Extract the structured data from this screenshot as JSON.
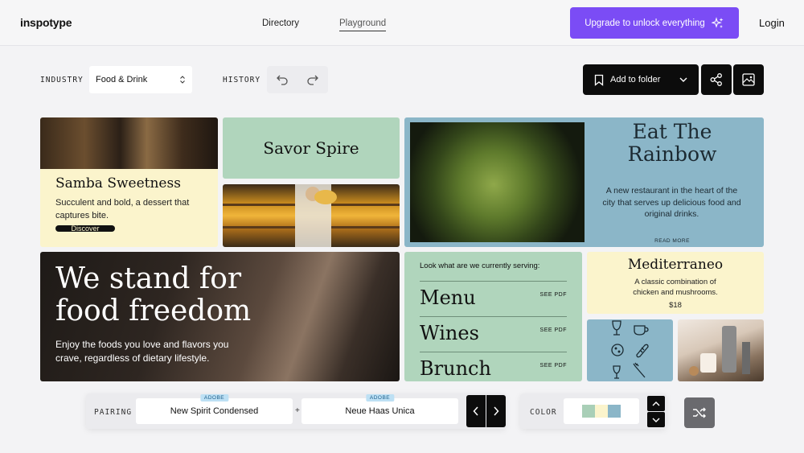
{
  "header": {
    "logo": "inspotype",
    "nav": [
      {
        "label": "Directory"
      },
      {
        "label": "Playground"
      }
    ],
    "upgrade_label": "Upgrade to unlock everything",
    "login_label": "Login"
  },
  "filters": {
    "industry_label": "INDUSTRY",
    "industry_value": "Food & Drink",
    "history_label": "HISTORY",
    "add_folder_label": "Add to folder"
  },
  "cards": {
    "samba": {
      "title": "Samba Sweetness",
      "body": "Succulent and bold, a dessert that captures bite.",
      "cta": "Discover"
    },
    "savor": {
      "title": "Savor Spire"
    },
    "rainbow": {
      "title": "Eat The Rainbow",
      "body": "A new restaurant in the heart of the city that serves up delicious food and original drinks.",
      "link": "READ MORE"
    },
    "freedom": {
      "title": "We stand for food freedom",
      "body": "Enjoy the foods you love and flavors you crave, regardless of dietary lifestyle."
    },
    "menu": {
      "heading": "Look what are we currently serving:",
      "items": [
        {
          "label": "Menu",
          "link": "SEE PDF"
        },
        {
          "label": "Wines",
          "link": "SEE PDF"
        },
        {
          "label": "Brunch",
          "link": "SEE PDF"
        }
      ]
    },
    "mediterraneo": {
      "title": "Mediterraneo",
      "body": "A classic combination of chicken and mushrooms.",
      "price": "$18"
    }
  },
  "toolbar": {
    "pairing_label": "PAIRING",
    "font1": {
      "name": "New Spirit Condensed",
      "tag": "ADOBE"
    },
    "plus": "+",
    "font2": {
      "name": "Neue Haas Unica",
      "tag": "ADOBE"
    },
    "color_label": "COLOR",
    "swatches": [
      "#a9cfb7",
      "#fbf4cc",
      "#8bb6c8"
    ]
  }
}
